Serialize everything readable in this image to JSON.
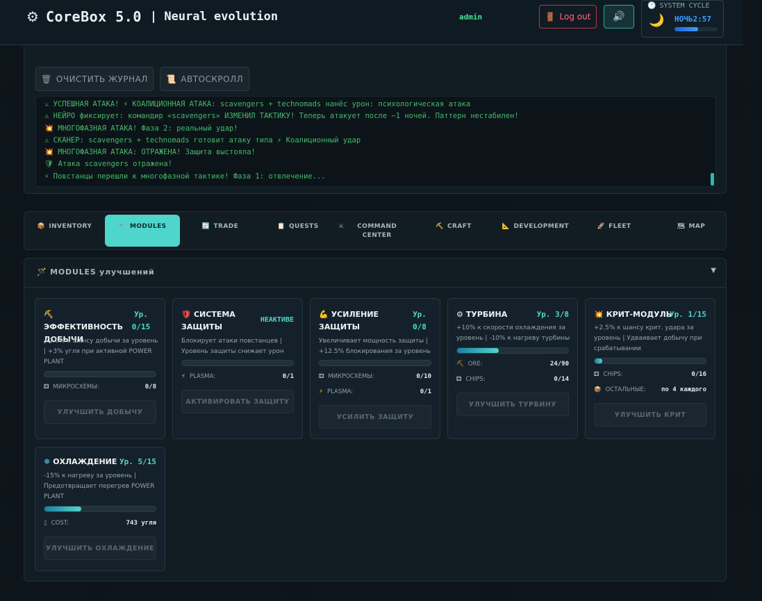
{
  "header": {
    "app_name": "CoreBox 5.0",
    "app_subtitle": "| Neural evolution",
    "user": "admin",
    "logout_label": "Log out",
    "sound_icon": "speaker-icon",
    "cycle": {
      "label": "SYSTEM CYCLE",
      "value": "НОЧЬ2:57",
      "progress": 0.55
    }
  },
  "log": {
    "clear_label": "ОЧИСТИТЬ ЖУРНАЛ",
    "autoscroll_label": "АВТОСКРОЛЛ",
    "lines": [
      "⚔ УСПЕШНАЯ АТАКА! ⚡ КОАЛИЦИОННАЯ АТАКА: scavengers + technomads нанёс урон: психологическая атака",
      "⚠ НЕЙРО фиксирует: командир «scavengers» ИЗМЕНИЛ ТАКТИКУ! Теперь атакует после ~1 ночей. Паттерн нестабилен!",
      "💥 МНОГОФАЗНАЯ АТАКА! Фаза 2: реальный удар!",
      "⚠ СКАНЕР: scavengers + technomads готовит атаку типа ⚡ Коалиционный удар",
      "💥 МНОГОФАЗНАЯ АТАКА: ОТРАЖЕНА! Защита выстояла!",
      "🛡 Атака scavengers отражена!",
      "⚡ Повстанцы перешли к многофазной тактике! Фаза 1: отвлечение..."
    ]
  },
  "tabs": [
    {
      "label": "INVENTORY",
      "icon": "📦"
    },
    {
      "label": "MODULES",
      "icon": "🔧"
    },
    {
      "label": "TRADE",
      "icon": "🔄"
    },
    {
      "label": "QUESTS",
      "icon": "📋"
    },
    {
      "label": "COMMAND CENTER",
      "icon": "⚔"
    },
    {
      "label": "CRAFT",
      "icon": "⛏"
    },
    {
      "label": "DEVELOPMENT",
      "icon": "📐"
    },
    {
      "label": "FLEET",
      "icon": "🚀"
    },
    {
      "label": "MAP",
      "icon": "🗺"
    }
  ],
  "modules": {
    "title": "MODULES улучшений",
    "toggle": "▼",
    "cards": [
      {
        "icon": "⛏",
        "title": "ЭФФЕКТИВНОСТЬ ДОБЫЧИ",
        "level": "Ур. 0/15",
        "desc": "+1.8% к шансу добычи за уровень | +3% угля при активной POWER PLANT",
        "progress": 0.0,
        "reqs": [
          {
            "icon": "⚃",
            "label": "МИКРОСХЕМЫ:",
            "value": "0/8"
          }
        ],
        "button": "УЛУЧШИТЬ ДОБЫЧУ"
      },
      {
        "icon": "🛡",
        "title": "СИСТЕМА ЗАЩИТЫ",
        "level": "НЕАКТИВЕ",
        "desc": "Блокирует атаки повстанцев | Уровень защиты снижает урон",
        "progress": 0.0,
        "reqs": [
          {
            "icon": "⚡",
            "label": "PLASMA:",
            "value": "0/1"
          }
        ],
        "button": "АКТИВИРОВАТЬ ЗАЩИТУ"
      },
      {
        "icon": "💪",
        "title": "УСИЛЕНИЕ ЗАЩИТЫ",
        "level": "Ур. 0/8",
        "desc": "Увеличивает мощность защиты | +12.5% блокирования за уровень",
        "progress": 0.0,
        "reqs": [
          {
            "icon": "⚃",
            "label": "МИКРОСХЕМЫ:",
            "value": "0/10"
          },
          {
            "icon": "⚡",
            "label": "PLASMA:",
            "value": "0/1"
          }
        ],
        "button": "УСИЛИТЬ ЗАЩИТУ"
      },
      {
        "icon": "⚙",
        "title": "ТУРБИНА",
        "level": "Ур. 3/8",
        "desc": "+10% к скорости охлаждения за уровень | -10% к нагреву турбины",
        "progress": 0.375,
        "reqs": [
          {
            "icon": "⛏",
            "label": "ORE:",
            "value": "24/90"
          },
          {
            "icon": "⚃",
            "label": "CHIPS:",
            "value": "0/14"
          }
        ],
        "button": "УЛУЧШИТЬ ТУРБИНУ"
      },
      {
        "icon": "💥",
        "title": "КРИТ-МОДУЛЬ",
        "level": "Ур. 1/15",
        "desc": "+2.5% к шансу крит. удара за уровень | Удваивает добычу при срабатывании",
        "progress": 0.067,
        "reqs": [
          {
            "icon": "⚃",
            "label": "CHIPS:",
            "value": "0/16"
          },
          {
            "icon": "📦",
            "label": "ОСТАЛЬНЫЕ:",
            "value": "по 4 каждого"
          }
        ],
        "button": "УЛУЧШИТЬ КРИТ"
      },
      {
        "icon": "❄",
        "title": "ОХЛАЖДЕНИЕ",
        "level": "Ур. 5/15",
        "desc": "-15% к нагреву за уровень | Предотвращает перегрев POWER PLANT",
        "progress": 0.333,
        "reqs": [
          {
            "icon": "▯",
            "label": "COST:",
            "value": "743 угля"
          }
        ],
        "button": "УЛУЧШИТЬ ОХЛАЖДЕНИЕ"
      }
    ]
  },
  "colors": {
    "accent": "#4fd6cc",
    "log_text": "#46b86a",
    "danger": "#ff6b85",
    "user": "#47e09a"
  }
}
